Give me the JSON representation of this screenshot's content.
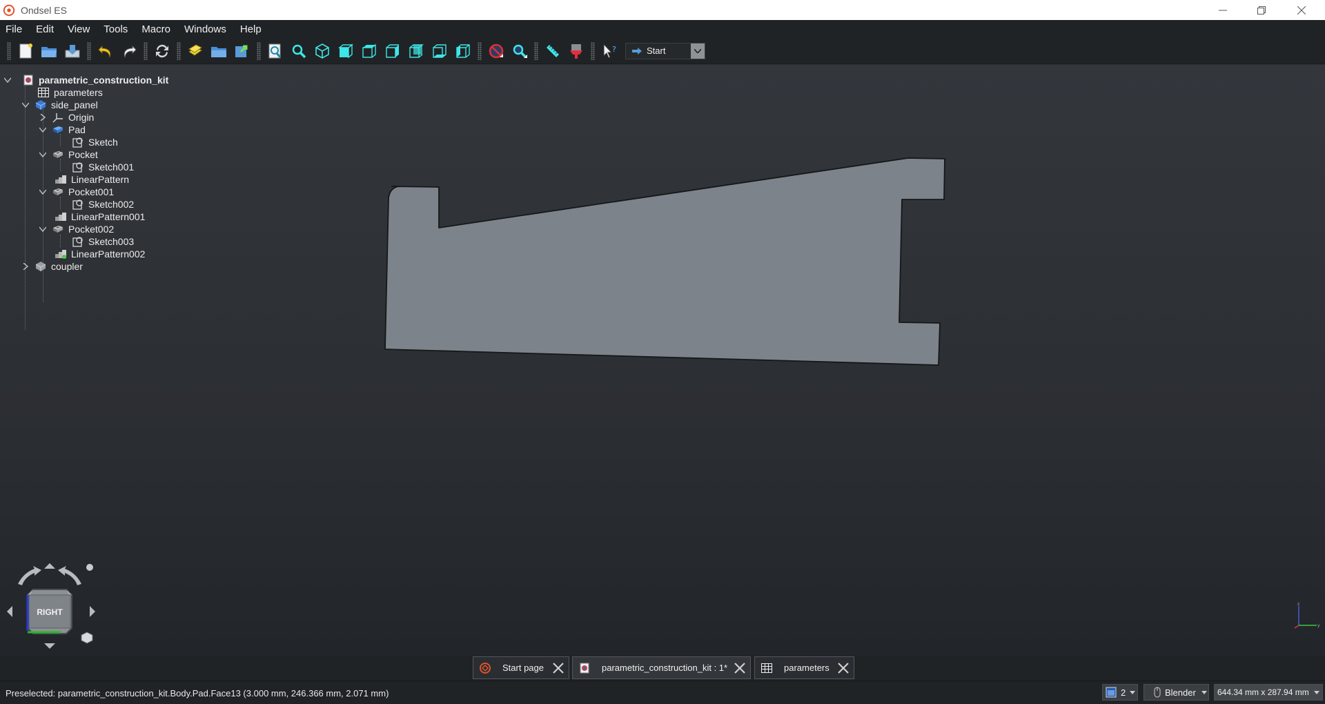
{
  "window": {
    "title": "Ondsel ES",
    "controls": [
      "minimize",
      "restore",
      "close"
    ]
  },
  "menu": [
    "File",
    "Edit",
    "View",
    "Tools",
    "Macro",
    "Windows",
    "Help"
  ],
  "toolbar": {
    "workbench_selector": "Start",
    "buttons": [
      "new-document-icon",
      "open-icon",
      "save-icon",
      "undo-icon",
      "redo-icon",
      "refresh-icon",
      "macro-recording-icon",
      "macros-folder-icon",
      "macro-execute-icon",
      "fit-all-icon",
      "fit-selection-icon",
      "isometric-view-icon",
      "front-view-icon",
      "top-view-icon",
      "right-view-icon",
      "rear-view-icon",
      "bottom-view-icon",
      "left-view-icon",
      "measure-clear-icon",
      "bounding-box-zoom-icon",
      "measure-icon",
      "cut-plane-icon",
      "whats-this-icon"
    ]
  },
  "tree": {
    "items": [
      {
        "label": "parametric_construction_kit",
        "icon": "document-icon",
        "expanded": true
      },
      {
        "label": "parameters",
        "icon": "spreadsheet-icon"
      },
      {
        "label": "side_panel",
        "icon": "body-icon",
        "expanded": true
      },
      {
        "label": "Origin",
        "icon": "origin-icon",
        "expanded": false
      },
      {
        "label": "Pad",
        "icon": "pad-icon",
        "expanded": true
      },
      {
        "label": "Sketch",
        "icon": "sketch-icon"
      },
      {
        "label": "Pocket",
        "icon": "pocket-icon",
        "expanded": true
      },
      {
        "label": "Sketch001",
        "icon": "sketch-icon"
      },
      {
        "label": "LinearPattern",
        "icon": "linear-pattern-icon"
      },
      {
        "label": "Pocket001",
        "icon": "pocket-icon",
        "expanded": true
      },
      {
        "label": "Sketch002",
        "icon": "sketch-icon"
      },
      {
        "label": "LinearPattern001",
        "icon": "linear-pattern-icon"
      },
      {
        "label": "Pocket002",
        "icon": "pocket-icon",
        "expanded": true
      },
      {
        "label": "Sketch003",
        "icon": "sketch-icon"
      },
      {
        "label": "LinearPattern002",
        "icon": "linear-pattern-tip-icon"
      },
      {
        "label": "coupler",
        "icon": "body-grey-icon",
        "expanded": false
      }
    ]
  },
  "navcube": {
    "face_label": "RIGHT"
  },
  "tabs": [
    {
      "label": "Start page",
      "icon": "start-icon",
      "active": false
    },
    {
      "label": "parametric_construction_kit : 1*",
      "icon": "document-icon",
      "active": true
    },
    {
      "label": "parameters",
      "icon": "spreadsheet-icon",
      "active": false
    }
  ],
  "statusbar": {
    "preselected": "Preselected: parametric_construction_kit.Body.Pad.Face13 (3.000 mm, 246.366 mm, 2.071 mm)",
    "view_count": "2",
    "navigation_style": "Blender",
    "dimensions": "644.34 mm x 287.94 mm"
  },
  "colors": {
    "shape_fill": "#7c838a",
    "accent_cyan": "#3ee6e6",
    "background_top": "#33373c",
    "background_bottom": "#22262a"
  }
}
